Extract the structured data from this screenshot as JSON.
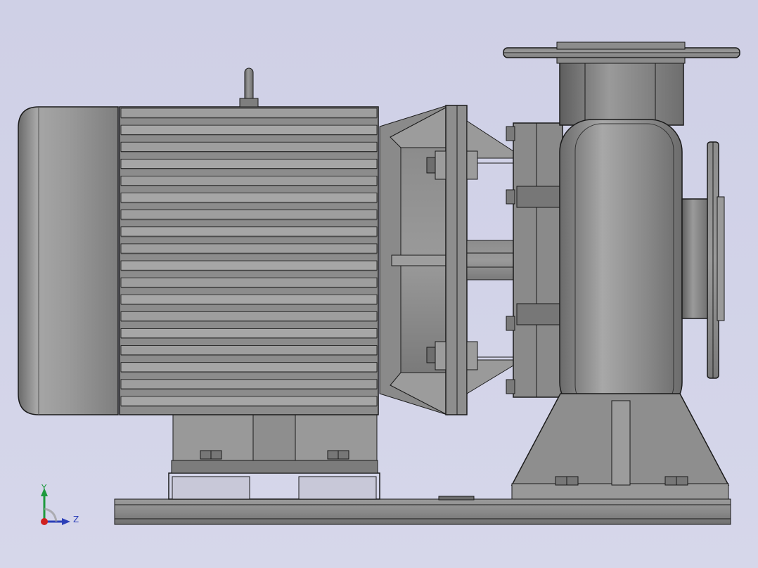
{
  "triad": {
    "y_label": "Y",
    "z_label": "Z",
    "colors": {
      "y_axis": "#1d9a3d",
      "z_axis": "#2c3fb8",
      "x_axis": "#d02020"
    }
  },
  "model": {
    "colors": {
      "background_top": "#cfd0e6",
      "background_bottom": "#d6d7ea",
      "metal_dark": "#5f5f5f",
      "metal_mid": "#8a8a8a",
      "metal_light": "#b0b0b0",
      "edge": "#1a1a1a"
    }
  }
}
